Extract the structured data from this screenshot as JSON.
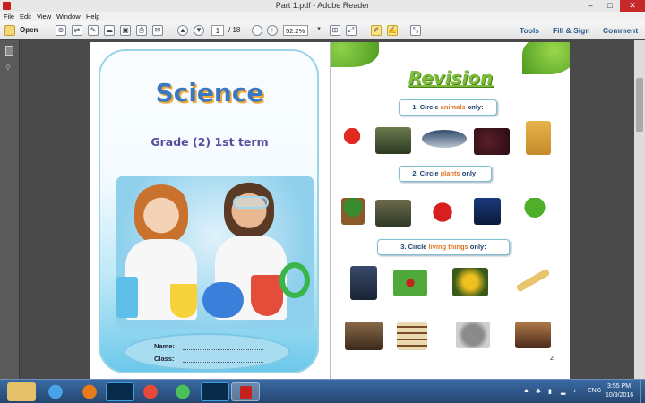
{
  "window": {
    "title": "Part 1.pdf - Adobe Reader",
    "minimize": "–",
    "maximize": "□",
    "close": "✕"
  },
  "menu": [
    "File",
    "Edit",
    "View",
    "Window",
    "Help"
  ],
  "toolbar": {
    "open_label": "Open",
    "current_page": "1",
    "total_pages": "/ 18",
    "zoom": "52.2%",
    "tools_label": "Tools",
    "fill_sign_label": "Fill & Sign",
    "comment_label": "Comment"
  },
  "cover": {
    "title": "Science",
    "grade": "Grade (2) 1st term",
    "name_label": "Name:",
    "class_label": "Class:"
  },
  "revision": {
    "title": "Revision",
    "q1": {
      "prefix": "1. Circle ",
      "highlight": "animals",
      "suffix": " only:"
    },
    "q2": {
      "prefix": "2. Circle ",
      "highlight": "plants",
      "suffix": " only:"
    },
    "q3": {
      "prefix": "3. Circle ",
      "highlight": "living things",
      "suffix": " only:"
    },
    "page_number": "2"
  },
  "taskbar": {
    "language": "ENG",
    "time": "3:55 PM",
    "date": "10/9/2016"
  },
  "colors": {
    "accent_link": "#2a5d8f",
    "taskbar": "#24466f",
    "close": "#c7282a"
  }
}
